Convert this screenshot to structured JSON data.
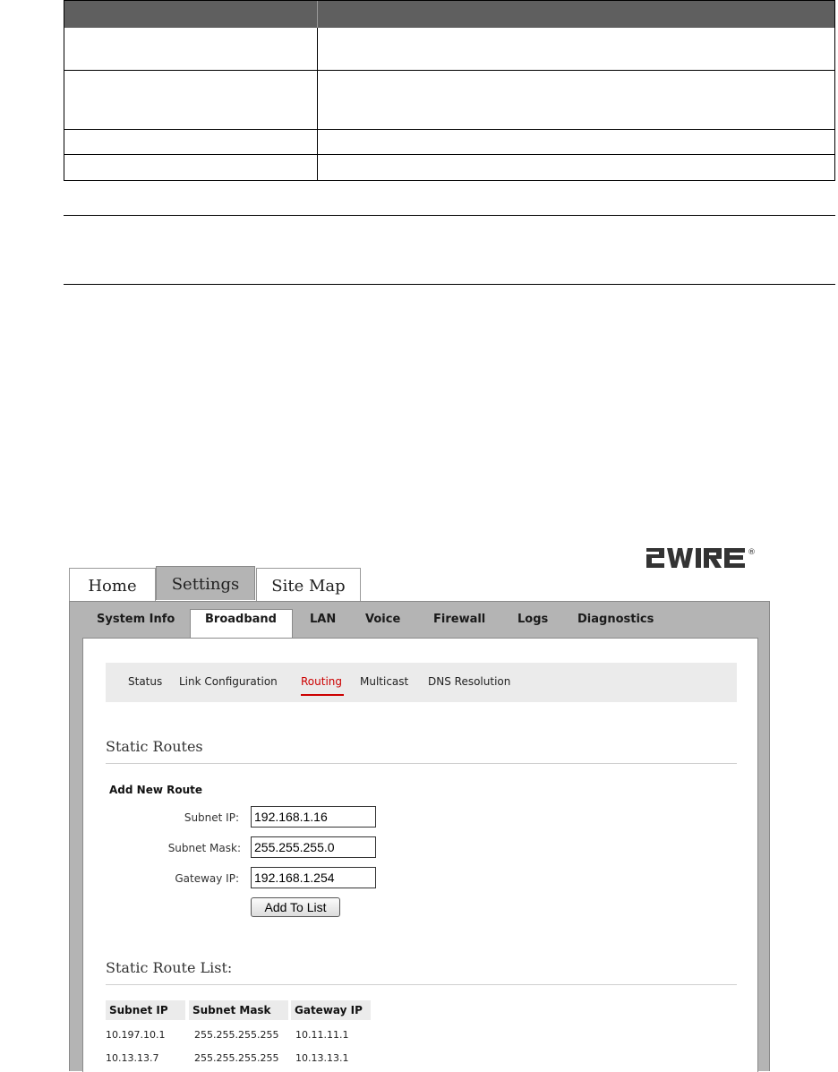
{
  "brand": {
    "logo_text": "2WIRE",
    "registered_mark": "®"
  },
  "main_tabs": [
    {
      "label": "Home",
      "active": false
    },
    {
      "label": "Settings",
      "active": true
    },
    {
      "label": "Site Map",
      "active": false
    }
  ],
  "sub_tabs": [
    {
      "label": "System Info",
      "active": false
    },
    {
      "label": "Broadband",
      "active": true
    },
    {
      "label": "LAN",
      "active": false
    },
    {
      "label": "Voice",
      "active": false
    },
    {
      "label": "Firewall",
      "active": false
    },
    {
      "label": "Logs",
      "active": false
    },
    {
      "label": "Diagnostics",
      "active": false
    }
  ],
  "sub_nav": [
    {
      "label": "Status",
      "active": false
    },
    {
      "label": "Link Configuration",
      "active": false
    },
    {
      "label": "Routing",
      "active": true
    },
    {
      "label": "Multicast",
      "active": false
    },
    {
      "label": "DNS Resolution",
      "active": false
    }
  ],
  "static_routes": {
    "title": "Static Routes",
    "form_heading": "Add New Route",
    "fields": {
      "subnet_ip": {
        "label": "Subnet IP:",
        "value": "192.168.1.16"
      },
      "subnet_mask": {
        "label": "Subnet Mask:",
        "value": "255.255.255.0"
      },
      "gateway_ip": {
        "label": "Gateway IP:",
        "value": "192.168.1.254"
      }
    },
    "add_button_label": "Add To List"
  },
  "route_list": {
    "title": "Static Route List:",
    "columns": [
      "Subnet IP",
      "Subnet Mask",
      "Gateway IP"
    ],
    "rows": [
      [
        "10.197.10.1",
        "255.255.255.255",
        "10.11.11.1"
      ],
      [
        "10.13.13.7",
        "255.255.255.255",
        "10.13.13.1"
      ]
    ]
  },
  "colors": {
    "accent_red": "#cc0000",
    "panel_gray": "#b4b4b4",
    "nav_bg": "#ebebeb",
    "doc_header": "#5f5f5f"
  }
}
